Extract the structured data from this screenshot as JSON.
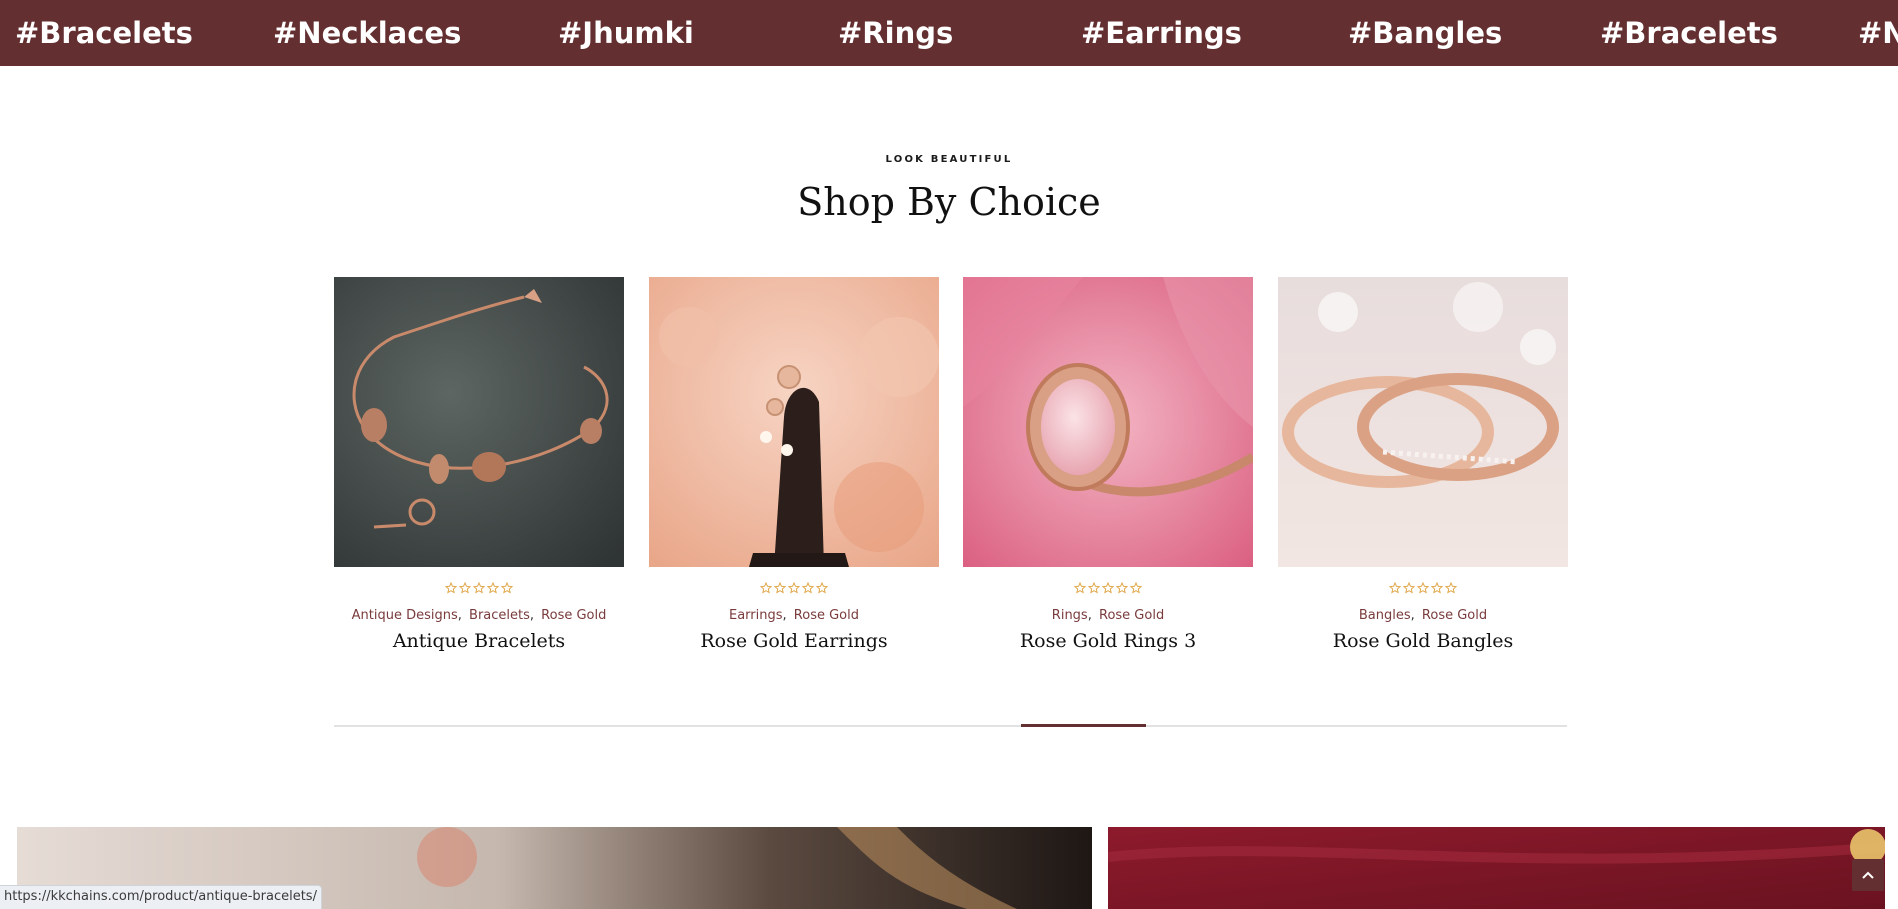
{
  "marquee": {
    "tags": [
      "#Bracelets",
      "#Necklaces",
      "#Jhumki",
      "#Rings",
      "#Earrings",
      "#Bangles",
      "#Bracelets",
      "#N"
    ],
    "background": "#642f30"
  },
  "section": {
    "eyebrow": "LOOK BEAUTIFUL",
    "title": "Shop By Choice"
  },
  "products": [
    {
      "title": "Antique Bracelets",
      "categories": [
        "Antique Designs",
        "Bracelets",
        "Rose Gold"
      ],
      "rating": 0,
      "image": "rose-gold-charm-bracelet"
    },
    {
      "title": "Rose Gold Earrings",
      "categories": [
        "Earrings",
        "Rose Gold"
      ],
      "rating": 0,
      "image": "rose-gold-drop-earrings"
    },
    {
      "title": "Rose Gold Rings 3",
      "categories": [
        "Rings",
        "Rose Gold"
      ],
      "rating": 0,
      "image": "pink-stone-halo-ring"
    },
    {
      "title": "Rose Gold Bangles",
      "categories": [
        "Bangles",
        "Rose Gold"
      ],
      "rating": 0,
      "image": "rose-gold-band-rings"
    }
  ],
  "slider": {
    "progress": 0.62
  },
  "status": {
    "url": "https://kkchains.com/product/antique-bracelets/"
  },
  "colors": {
    "accent": "#642f30",
    "category": "#7a3b3c",
    "star": "#e0a84b"
  },
  "icons": {
    "back_to_top": "chevron-up-icon",
    "star": "star-outline-icon"
  }
}
